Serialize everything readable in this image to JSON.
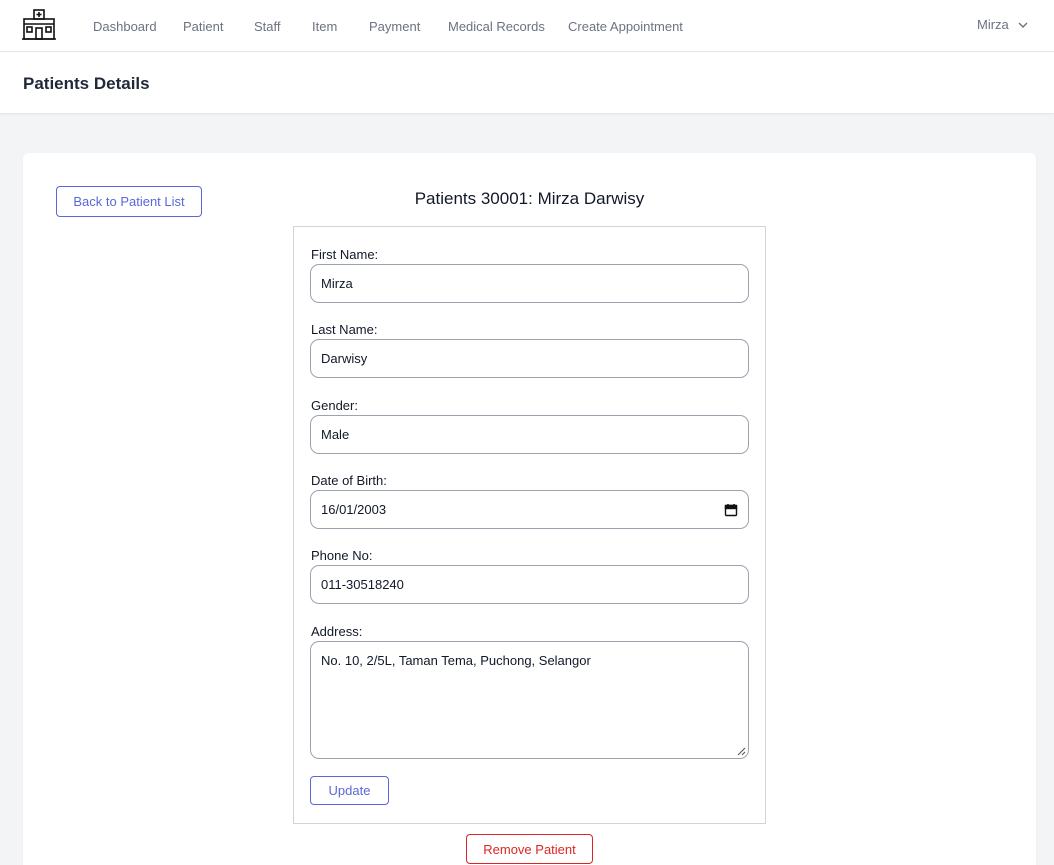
{
  "nav": {
    "links": [
      "Dashboard",
      "Patient",
      "Staff",
      "Item",
      "Payment",
      "Medical Records",
      "Create Appointment"
    ],
    "user": "Mirza"
  },
  "header": {
    "title": "Patients Details"
  },
  "main": {
    "back_button": "Back to Patient List",
    "record_title": "Patients 30001: Mirza Darwisy",
    "form": {
      "first_name": {
        "label": "First Name:",
        "value": "Mirza"
      },
      "last_name": {
        "label": "Last Name:",
        "value": "Darwisy"
      },
      "gender": {
        "label": "Gender:",
        "value": "Male"
      },
      "dob": {
        "label": "Date of Birth:",
        "value": "16/01/2003"
      },
      "phone": {
        "label": "Phone No:",
        "value": "011-30518240"
      },
      "address": {
        "label": "Address:",
        "value": "No. 10, 2/5L, Taman Tema, Puchong, Selangor"
      }
    },
    "update_button": "Update",
    "remove_button": "Remove Patient"
  },
  "colors": {
    "primary": "#5a67d8",
    "danger": "#dc2626",
    "nav_text": "#6b7280",
    "background": "#f3f4f6"
  },
  "icons": [
    "hospital-logo-icon",
    "chevron-down-icon",
    "calendar-icon",
    "resize-grip-icon"
  ]
}
